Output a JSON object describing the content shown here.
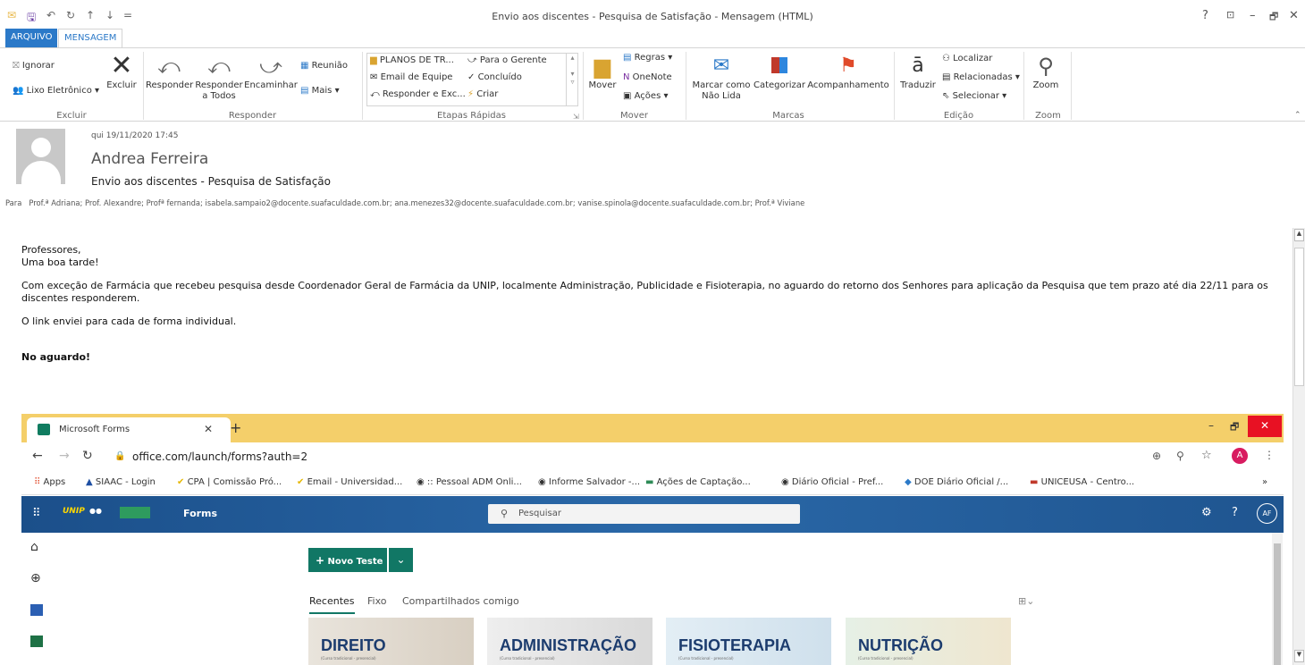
{
  "window": {
    "title": "Envio aos discentes - Pesquisa de Satisfação - Mensagem (HTML)",
    "controls": [
      "?",
      "⊡",
      "–",
      "🗗",
      "✕"
    ]
  },
  "tabs": [
    {
      "label": "ARQUIVO"
    },
    {
      "label": "MENSAGEM"
    }
  ],
  "ribbon": {
    "groups": [
      "Excluir",
      "Responder",
      "Etapas Rápidas",
      "Mover",
      "Marcas",
      "Edição",
      "Zoom"
    ],
    "excluir": {
      "ignorar": "Ignorar",
      "lixo": "Lixo Eletrônico ▾",
      "excluir": "Excluir"
    },
    "responder": {
      "responder": "Responder",
      "responder_todos_1": "Responder",
      "responder_todos_2": "a Todos",
      "encaminhar": "Encaminhar",
      "reuniao": "Reunião",
      "mais": "Mais ▾"
    },
    "etapas": {
      "planos": "PLANOS DE TR...",
      "email_equipe": "Email de Equipe",
      "responder_exc": "Responder e Exc...",
      "para_gerente": "Para o Gerente",
      "concluido": "Concluído",
      "criar": "Criar"
    },
    "mover": {
      "mover": "Mover",
      "regras": "Regras ▾",
      "onenote": "OneNote",
      "acoes": "Ações ▾"
    },
    "marcas": {
      "marcar_1": "Marcar como",
      "marcar_2": "Não Lida",
      "categorizar": "Categorizar",
      "acompanhamento": "Acompanhamento"
    },
    "edicao": {
      "traduzir": "Traduzir",
      "localizar": "Localizar",
      "relacionadas": "Relacionadas ▾",
      "selecionar": "Selecionar ▾"
    },
    "zoom": {
      "zoom": "Zoom"
    }
  },
  "header": {
    "date": "qui 19/11/2020 17:45",
    "sender": "Andrea Ferreira",
    "subject": "Envio aos discentes - Pesquisa de Satisfação",
    "to_label": "Para",
    "recipients": "Prof.ª Adriana; Prof. Alexandre; Profª fernanda; isabela.sampaio2@docente.suafaculdade.com.br; ana.menezes32@docente.suafaculdade.com.br; vanise.spinola@docente.suafaculdade.com.br; Prof.ª Viviane"
  },
  "body": {
    "line1": "Professores,",
    "line2": "Uma boa tarde!",
    "para1": "Com exceção de Farmácia que recebeu pesquisa desde Coordenador Geral de Farmácia da UNIP, localmente Administração, Publicidade e Fisioterapia, no aguardo do retorno dos Senhores para aplicação da Pesquisa que tem prazo até dia 22/11 para os discentes responderem.",
    "para2": "O link enviei para cada de forma individual.",
    "closing": "No aguardo!"
  },
  "browser": {
    "tab_title": "Microsoft Forms",
    "url": "office.com/launch/forms?auth=2",
    "profile_initial": "A",
    "bookmarks": [
      "Apps",
      "SIAAC - Login",
      "CPA | Comissão Pró...",
      "Email - Universidad...",
      ":: Pessoal ADM Onli...",
      "Informe Salvador -...",
      "Ações de Captação...",
      "Diário Oficial - Pref...",
      "DOE Diário Oficial /...",
      "UNICEUSA - Centro..."
    ],
    "forms": {
      "app_name": "Forms",
      "search_placeholder": "Pesquisar",
      "user_initials": "AF",
      "new_button": "Novo Teste",
      "content_tabs": [
        "Recentes",
        "Fixo",
        "Compartilhados comigo"
      ],
      "cards": [
        {
          "title": "DIREITO",
          "sub": "(Curso tradicional - presencial)"
        },
        {
          "title": "ADMINISTRAÇÃO",
          "sub": "(Curso tradicional - presencial)"
        },
        {
          "title": "FISIOTERAPIA",
          "sub": "(Curso tradicional - presencial)"
        },
        {
          "title": "NUTRIÇÃO",
          "sub": "(Curso tradicional - presencial)"
        }
      ]
    }
  }
}
